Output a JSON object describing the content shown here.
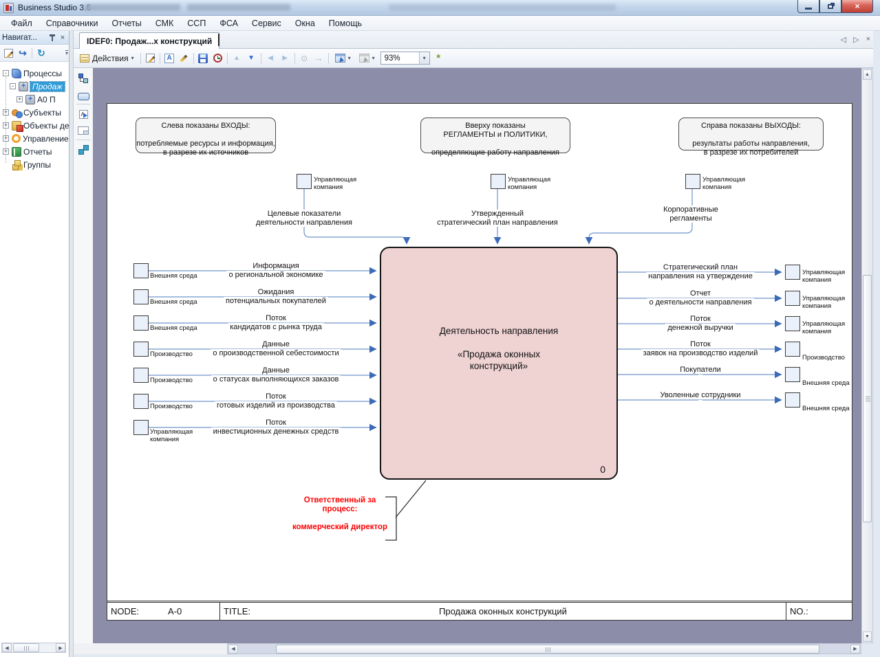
{
  "window": {
    "title": "Business Studio 3.6"
  },
  "menu": {
    "items": [
      "Файл",
      "Справочники",
      "Отчеты",
      "СМК",
      "ССП",
      "ФСА",
      "Сервис",
      "Окна",
      "Помощь"
    ]
  },
  "navigator": {
    "title": "Навигат...",
    "items": [
      {
        "label": "Процессы"
      },
      {
        "label": "Продаж"
      },
      {
        "label": "А0 П"
      },
      {
        "label": "Субъекты"
      },
      {
        "label": "Объекты де"
      },
      {
        "label": "Управление"
      },
      {
        "label": "Отчеты"
      },
      {
        "label": "Группы"
      }
    ]
  },
  "tabs": {
    "active": "IDEF0: Продаж...х конструкций"
  },
  "toolbar": {
    "actions": "Действия",
    "zoom": "93%"
  },
  "icons": {
    "dropdown": "▾",
    "plus": "+",
    "minus": "-",
    "close": "×",
    "tab_prev": "◁",
    "tab_next": "▷",
    "tab_close": "×",
    "up_arrow": "▲",
    "down_arrow": "▼",
    "left_arrow": "◀",
    "right_arrow": "▶",
    "back_circle": "⊙",
    "forward_arrow": "→",
    "redo": "↪",
    "refresh": "↻",
    "fit": "*",
    "text_letter": "A"
  },
  "colors": {
    "canvas_background": "#8c8da8",
    "process_box_fill": "#efd2d2",
    "flow_line": "#6f94c9",
    "arrowhead": "#3a6ab8",
    "selection": "#2f9cd8",
    "annotation_red": "#ff0000"
  },
  "diagram": {
    "notes": {
      "left": {
        "l1": "Слева показаны ВХОДЫ:",
        "l2": "потребляемые ресурсы и информация,",
        "l3": "в разрезе их источников"
      },
      "top": {
        "l1": "Вверху показаны",
        "l2": "РЕГЛАМЕНТЫ и ПОЛИТИКИ,",
        "l3": "определяющие работу направления"
      },
      "right": {
        "l1": "Справа показаны ВЫХОДЫ:",
        "l2": "результаты работы направления,",
        "l3": "в разрезе их потребителей"
      }
    },
    "controls": [
      {
        "e1": "Управляющая",
        "e2": "компания",
        "l1": "Целевые показатели",
        "l2": "деятельности направления"
      },
      {
        "e1": "Управляющая",
        "e2": "компания",
        "l1": "Утвержденный",
        "l2": "стратегический план направления"
      },
      {
        "e1": "Управляющая",
        "e2": "компания",
        "l1": "Корпоративные",
        "l2": "регламенты"
      }
    ],
    "inputs": [
      {
        "e1": "Внешняя среда",
        "e2": "",
        "l1": "Информация",
        "l2": "о региональной экономике"
      },
      {
        "e1": "Внешняя среда",
        "e2": "",
        "l1": "Ожидания",
        "l2": "потенциальных покупателей"
      },
      {
        "e1": "Внешняя среда",
        "e2": "",
        "l1": "Поток",
        "l2": "кандидатов с рынка труда"
      },
      {
        "e1": "Производство",
        "e2": "",
        "l1": "Данные",
        "l2": "о производственной себестоимости"
      },
      {
        "e1": "Производство",
        "e2": "",
        "l1": "Данные",
        "l2": "о статусах выполняющихся заказов"
      },
      {
        "e1": "Производство",
        "e2": "",
        "l1": "Поток",
        "l2": "готовых изделий из производства"
      },
      {
        "e1": "Управляющая",
        "e2": "компания",
        "l1": "Поток",
        "l2": "инвестиционных денежных средств"
      }
    ],
    "outputs": [
      {
        "e1": "Управляющая",
        "e2": "компания",
        "l1": "Стратегический план",
        "l2": "направления на утверждение"
      },
      {
        "e1": "Управляющая",
        "e2": "компания",
        "l1": "Отчет",
        "l2": "о деятельности направления"
      },
      {
        "e1": "Управляющая",
        "e2": "компания",
        "l1": "Поток",
        "l2": "денежной выручки"
      },
      {
        "e1": "Производство",
        "e2": "",
        "l1": "Поток",
        "l2": "заявок на производство изделий"
      },
      {
        "e1": "Внешняя среда",
        "e2": "",
        "l1": "Покупатели",
        "l2": ""
      },
      {
        "e1": "Внешняя среда",
        "e2": "",
        "l1": "Уволенные сотрудники",
        "l2": ""
      }
    ],
    "box": {
      "l1": "Деятельность направления",
      "l2": "«Продажа оконных",
      "l3": "конструкций»",
      "num": "0"
    },
    "annotation": {
      "l1": "Ответственный за",
      "l2": "процесс:",
      "l3": "коммерческий директор"
    },
    "footer": {
      "node_label": "NODE:",
      "node_value": "A-0",
      "title_label": "TITLE:",
      "title_value": "Продажа оконных конструкций",
      "no_label": "NO.:"
    }
  }
}
